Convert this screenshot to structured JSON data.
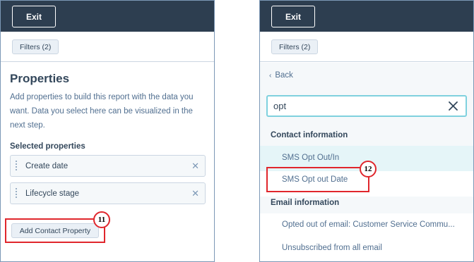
{
  "left": {
    "exit_label": "Exit",
    "filters_label": "Filters (2)",
    "title": "Properties",
    "description": "Add properties to build this report with the data you want. Data you select here can be visualized in the next step.",
    "selected_label": "Selected properties",
    "selected": [
      {
        "label": "Create date"
      },
      {
        "label": "Lifecycle stage"
      }
    ],
    "add_button": "Add Contact Property",
    "badge": "11"
  },
  "right": {
    "exit_label": "Exit",
    "filters_label": "Filters (2)",
    "back_label": "Back",
    "search_value": "opt",
    "groups": [
      {
        "header": "Contact information",
        "options": [
          "SMS Opt Out/In",
          "SMS Opt out Date"
        ]
      },
      {
        "header": "Email information",
        "options": [
          "Opted out of email: Customer Service Commu...",
          "Unsubscribed from all email"
        ]
      }
    ],
    "badge": "12"
  },
  "colors": {
    "topbar": "#2d3e50",
    "annotation": "#e0262c",
    "search_focus": "#7fd1de",
    "highlight": "#e5f5f8"
  }
}
